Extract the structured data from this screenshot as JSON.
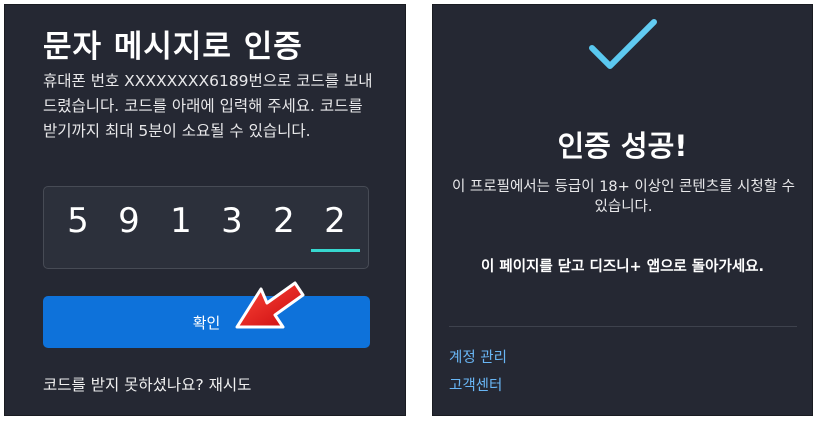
{
  "verify_screen": {
    "title": "문자 메시지로 인증",
    "description": "휴대폰 번호 XXXXXXXX6189번으로 코드를 보내드렸습니다. 코드를 아래에 입력해 주세요. 코드를 받기까지 최대 5분이 소요될 수 있습니다.",
    "code_digits": [
      "5",
      "9",
      "1",
      "3",
      "2",
      "2"
    ],
    "confirm_label": "확인",
    "resend_prompt": "코드를 받지 못하셨나요?",
    "retry_label": "재시도",
    "colors": {
      "background": "#252833",
      "button": "#0e72da",
      "cursor_underline": "#37d7cf",
      "arrow": "#e4151b"
    },
    "icons": {
      "arrow_annotation": "red-arrow-icon"
    }
  },
  "success_screen": {
    "title": "인증 성공!",
    "info": "이 프로필에서는 등급이 18+ 이상인 콘텐츠를 시청할 수 있습니다.",
    "close_message": "이 페이지를 닫고 디즈니+ 앱으로 돌아가세요.",
    "links": {
      "account": "계정 관리",
      "support": "고객센터"
    },
    "colors": {
      "link": "#69b6f5",
      "check": "#5fc9f0"
    },
    "icons": {
      "check": "checkmark-icon"
    }
  }
}
